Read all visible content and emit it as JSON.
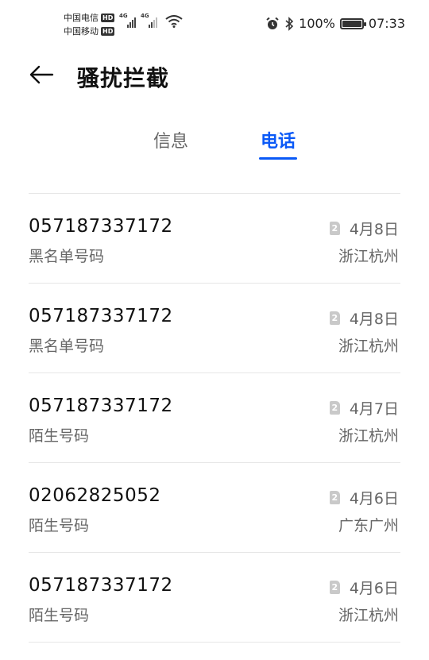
{
  "status_bar": {
    "carrier1": "中国电信",
    "carrier2": "中国移动",
    "hd": "HD",
    "net1": "4G",
    "net2": "4G",
    "battery_text": "100%",
    "battery_level": 1.0,
    "time": "07:33"
  },
  "header": {
    "title": "骚扰拦截"
  },
  "tabs": [
    {
      "label": "信息",
      "active": false
    },
    {
      "label": "电话",
      "active": true
    }
  ],
  "calls": [
    {
      "number": "057187337172",
      "type": "黑名单号码",
      "sim": "2",
      "date": "4月8日",
      "location": "浙江杭州"
    },
    {
      "number": "057187337172",
      "type": "黑名单号码",
      "sim": "2",
      "date": "4月8日",
      "location": "浙江杭州"
    },
    {
      "number": "057187337172",
      "type": "陌生号码",
      "sim": "2",
      "date": "4月7日",
      "location": "浙江杭州"
    },
    {
      "number": "02062825052",
      "type": "陌生号码",
      "sim": "2",
      "date": "4月6日",
      "location": "广东广州"
    },
    {
      "number": "057187337172",
      "type": "陌生号码",
      "sim": "2",
      "date": "4月6日",
      "location": "浙江杭州"
    }
  ],
  "colors": {
    "accent": "#0a59f7",
    "secondary_text": "#666666",
    "divider": "#e6e6e6"
  }
}
